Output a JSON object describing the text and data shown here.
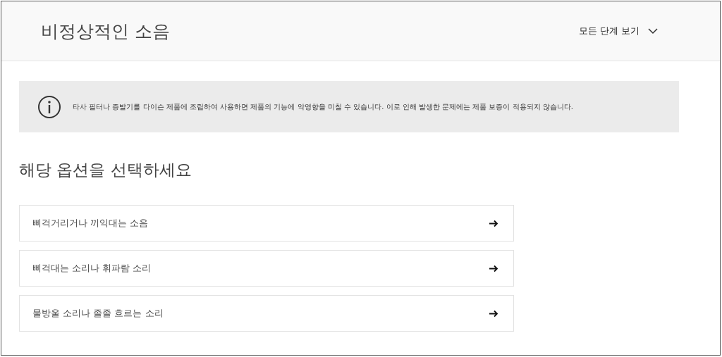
{
  "header": {
    "title": "비정상적인 소음",
    "steps_toggle": "모든 단계 보기"
  },
  "notice": {
    "text": "타사 필터나 증발기를 다이슨 제품에 조립하여 사용하면 제품의 기능에 악영향을 미칠 수 있습니다. 이로 인해 발생한 문제에는 제품 보증이 적용되지 않습니다."
  },
  "question": "해당 옵션을 선택하세요",
  "options": [
    {
      "label": "삐걱거리거나 끼익대는 소음"
    },
    {
      "label": "삐걱대는 소리나 휘파람 소리"
    },
    {
      "label": "물방울 소리나 졸졸 흐르는 소리"
    }
  ]
}
